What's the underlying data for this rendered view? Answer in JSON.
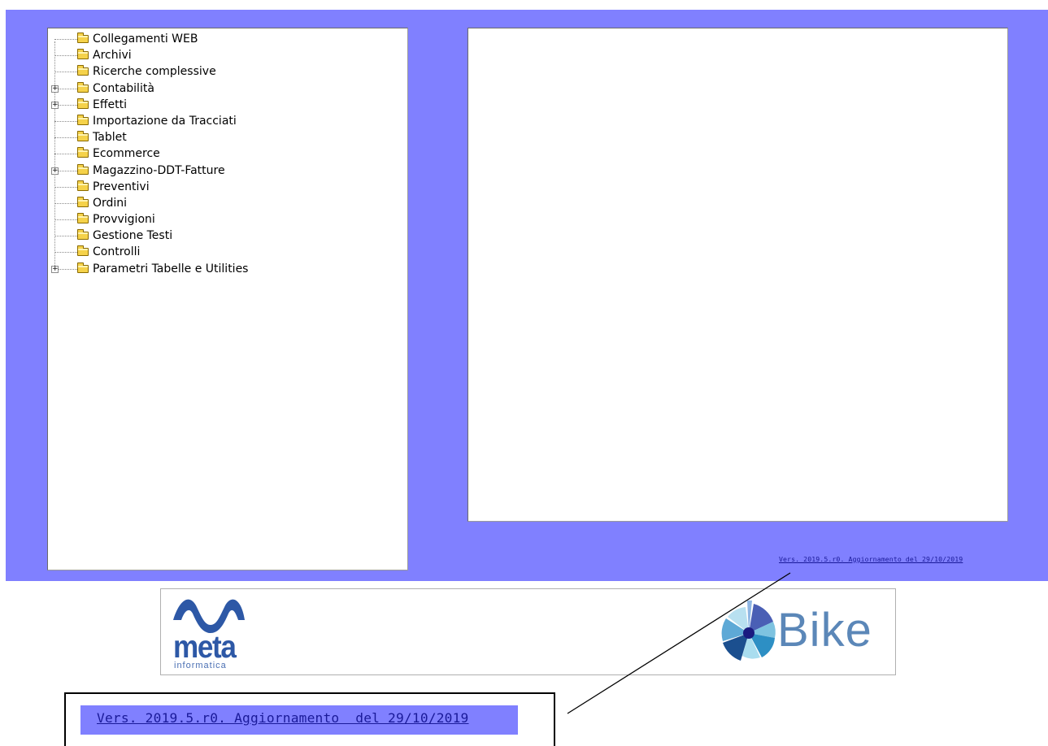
{
  "tree": {
    "items": [
      {
        "label": "Collegamenti WEB",
        "expandable": false
      },
      {
        "label": "Archivi",
        "expandable": false
      },
      {
        "label": "Ricerche complessive",
        "expandable": false
      },
      {
        "label": "Contabilità",
        "expandable": true
      },
      {
        "label": "Effetti",
        "expandable": true
      },
      {
        "label": "Importazione da Tracciati",
        "expandable": false
      },
      {
        "label": "Tablet",
        "expandable": false
      },
      {
        "label": "Ecommerce",
        "expandable": false
      },
      {
        "label": "Magazzino-DDT-Fatture",
        "expandable": true
      },
      {
        "label": "Preventivi",
        "expandable": false
      },
      {
        "label": "Ordini",
        "expandable": false
      },
      {
        "label": "Provvigioni",
        "expandable": false
      },
      {
        "label": "Gestione Testi",
        "expandable": false
      },
      {
        "label": "Controlli",
        "expandable": false
      },
      {
        "label": "Parametri Tabelle e Utilities",
        "expandable": true
      }
    ],
    "expander_glyph": "+",
    "icon": "folder-icon"
  },
  "footer": {
    "version_link": "Vers. 2019.5.r0. Aggiornamento  del 29/10/2019"
  },
  "logos": {
    "meta_word": "meta",
    "meta_sub": "informatica",
    "bike_word": "Bike"
  },
  "zoom_callout": {
    "text": "Vers. 2019.5.r0. Aggiornamento  del 29/10/2019"
  },
  "colors": {
    "frame_background": "#8080ff",
    "link": "#1a1a99",
    "meta_blue": "#2d58a6",
    "bike_blue": "#5b87b8"
  }
}
